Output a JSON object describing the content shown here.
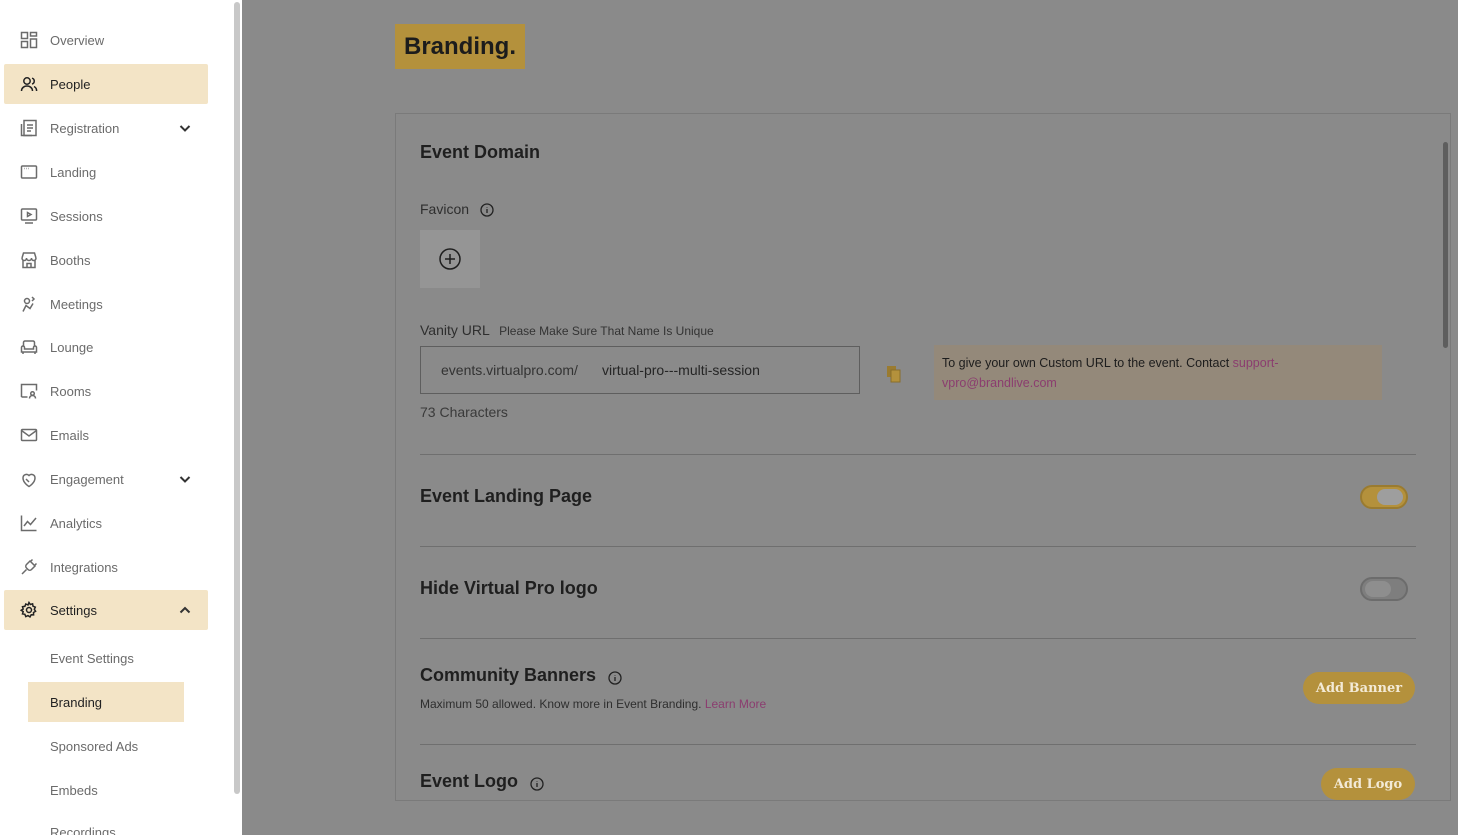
{
  "sidebar": {
    "items": [
      {
        "label": "Overview",
        "icon": "grid-icon"
      },
      {
        "label": "People",
        "icon": "people-icon"
      },
      {
        "label": "Registration",
        "icon": "form-icon"
      },
      {
        "label": "Landing",
        "icon": "window-icon"
      },
      {
        "label": "Sessions",
        "icon": "play-screen-icon"
      },
      {
        "label": "Booths",
        "icon": "storefront-icon"
      },
      {
        "label": "Meetings",
        "icon": "handshake-icon"
      },
      {
        "label": "Lounge",
        "icon": "sofa-icon"
      },
      {
        "label": "Rooms",
        "icon": "room-icon"
      },
      {
        "label": "Emails",
        "icon": "mail-icon"
      },
      {
        "label": "Engagement",
        "icon": "engagement-icon"
      },
      {
        "label": "Analytics",
        "icon": "line-chart-icon"
      },
      {
        "label": "Integrations",
        "icon": "plug-icon"
      },
      {
        "label": "Settings",
        "icon": "gear-icon"
      }
    ],
    "settings_sub": [
      {
        "label": "Event Settings"
      },
      {
        "label": "Branding"
      },
      {
        "label": "Sponsored Ads"
      },
      {
        "label": "Embeds"
      },
      {
        "label": "Recordings"
      }
    ]
  },
  "main": {
    "title": "Branding.",
    "event_domain": {
      "heading": "Event Domain",
      "favicon_label": "Favicon",
      "vanity_label": "Vanity URL",
      "vanity_hint": "Please Make Sure That Name Is Unique",
      "url_prefix": "events.virtualpro.com/",
      "url_value": "virtual-pro---multi-session",
      "char_count": "73 Characters",
      "notice_text": "To give your own Custom URL to the event. Contact ",
      "notice_link_1": "support-",
      "notice_link_2": "vpro@brandlive.com"
    },
    "landing_page": {
      "heading": "Event Landing Page",
      "enabled": true
    },
    "hide_logo": {
      "heading": "Hide Virtual Pro logo",
      "enabled": false
    },
    "community_banners": {
      "heading": "Community Banners",
      "desc": "Maximum 50 allowed. Know more in Event Branding. ",
      "link": "Learn More",
      "button": "Add Banner"
    },
    "event_logo": {
      "heading": "Event Logo",
      "button": "Add Logo"
    }
  },
  "colors": {
    "accent": "#b4913c",
    "active_bg": "#f3e4c6",
    "link": "#8b3d6f"
  }
}
